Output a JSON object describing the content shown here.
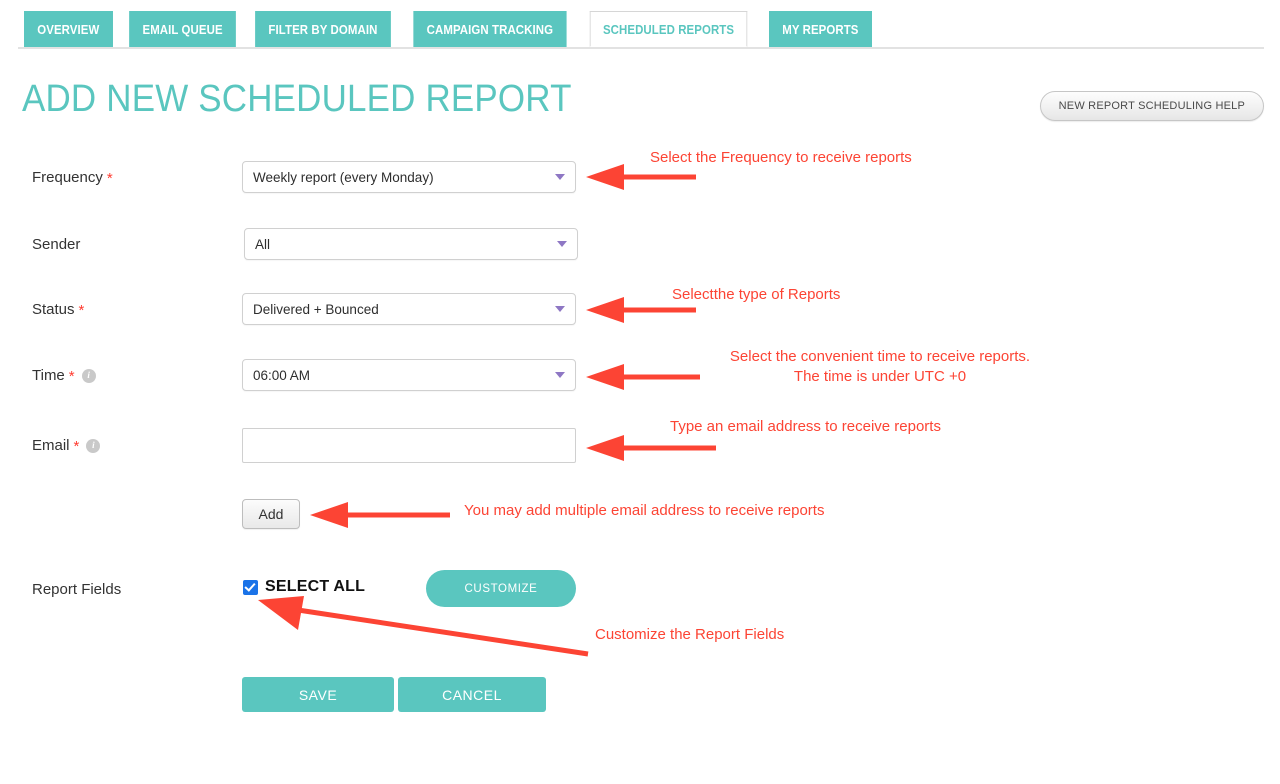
{
  "tabs": [
    {
      "label": "OVERVIEW",
      "active": false
    },
    {
      "label": "EMAIL QUEUE",
      "active": false
    },
    {
      "label": "FILTER BY DOMAIN",
      "active": false
    },
    {
      "label": "CAMPAIGN TRACKING",
      "active": false
    },
    {
      "label": "SCHEDULED REPORTS",
      "active": true
    },
    {
      "label": "MY REPORTS",
      "active": false
    }
  ],
  "header": {
    "title": "ADD NEW SCHEDULED REPORT",
    "help_button": "NEW REPORT SCHEDULING HELP"
  },
  "form": {
    "frequency": {
      "label": "Frequency",
      "required": "*",
      "value": "Weekly report (every Monday)"
    },
    "sender": {
      "label": "Sender",
      "value": "All"
    },
    "status": {
      "label": "Status",
      "required": "*",
      "value": "Delivered + Bounced"
    },
    "time": {
      "label": "Time",
      "required": "*",
      "info": "i",
      "value": "06:00 AM"
    },
    "email": {
      "label": "Email",
      "required": "*",
      "info": "i",
      "value": "",
      "placeholder": ""
    },
    "add_button": "Add",
    "report_fields": {
      "label": "Report Fields",
      "select_all": "SELECT ALL",
      "checked": true,
      "customize_button": "CUSTOMIZE"
    },
    "save_button": "SAVE",
    "cancel_button": "CANCEL"
  },
  "annotations": {
    "frequency": "Select the Frequency to receive reports",
    "status": "Selectthe type of Reports",
    "time_line1": "Select the convenient time to receive reports.",
    "time_line2": "The time is under UTC +0",
    "email": "Type an email address to receive reports",
    "add": "You may add multiple email address to receive reports",
    "customize": "Customize the Report Fields"
  },
  "colors": {
    "teal": "#5ac6bf",
    "annotation_red": "#fc4434",
    "required_red": "#ff3b30",
    "checkbox_blue": "#1a73e8",
    "caret_purple": "#8e77c4"
  }
}
